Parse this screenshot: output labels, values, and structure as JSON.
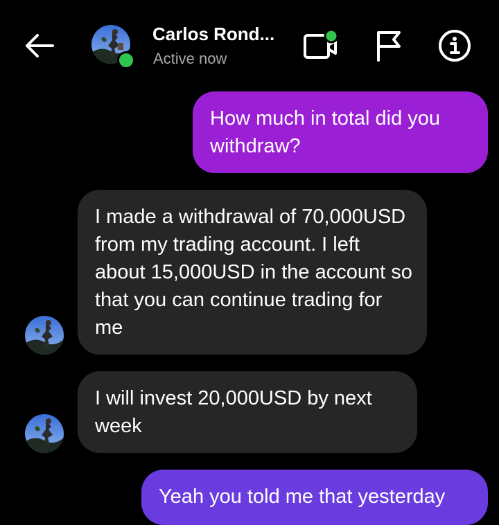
{
  "header": {
    "contact_name": "Carlos Rond...",
    "status": "Active now",
    "presence_color": "#31c44f",
    "icons": [
      "back-arrow-icon",
      "video-call-icon",
      "flag-icon",
      "info-icon"
    ]
  },
  "messages": [
    {
      "direction": "outgoing",
      "text": "How much in total did you withdraw?"
    },
    {
      "direction": "incoming",
      "text": "I made a withdrawal of 70,000USD from my trading account. I left about 15,000USD in the account so that you can continue trading for me"
    },
    {
      "direction": "incoming",
      "text": "I will invest 20,000USD by next week"
    },
    {
      "direction": "outgoing",
      "text": "Yeah you told me that yesterday"
    }
  ],
  "colors": {
    "background": "#000000",
    "outgoing_bubble": "#9b1fd4",
    "outgoing_bubble_bottom": "#6a3ce0",
    "incoming_bubble": "#262626",
    "status_text": "#a8a8a8"
  }
}
